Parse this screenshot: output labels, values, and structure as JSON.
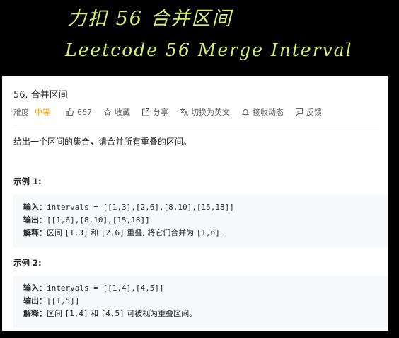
{
  "handwriting": {
    "line1": "力扣 56 合并区间",
    "line2": "Leetcode 56 Merge Interval"
  },
  "problem": {
    "title": "56. 合并区间",
    "difficulty_label": "难度",
    "difficulty": "中等",
    "difficulty_color": "#ffa116",
    "actions": [
      {
        "icon": "thumbs-up-icon",
        "label": "667"
      },
      {
        "icon": "star-icon",
        "label": "收藏"
      },
      {
        "icon": "share-icon",
        "label": "分享"
      },
      {
        "icon": "translate-icon",
        "label": "切换为英文"
      },
      {
        "icon": "bell-icon",
        "label": "接收动态"
      },
      {
        "icon": "feedback-icon",
        "label": "反馈"
      }
    ],
    "description": "给出一个区间的集合，请合并所有重叠的区间。",
    "examples": [
      {
        "title": "示例 1:",
        "input_label": "输入：",
        "input": "intervals = [[1,3],[2,6],[8,10],[15,18]]",
        "output_label": "输出：",
        "output": "[[1,6],[8,10],[15,18]]",
        "explain_label": "解释：",
        "explain_a": "区间 ",
        "explain_b": "[1,3]",
        "explain_c": " 和 ",
        "explain_d": "[2,6]",
        "explain_e": " 重叠, 将它们合并为 ",
        "explain_f": "[1,6]",
        "explain_g": "."
      },
      {
        "title": "示例 2:",
        "input_label": "输入：",
        "input": "intervals = [[1,4],[4,5]]",
        "output_label": "输出：",
        "output": "[[1,5]]",
        "explain_label": "解释：",
        "explain_a": "区间 ",
        "explain_b": "[1,4]",
        "explain_c": " 和 ",
        "explain_d": "[4,5]",
        "explain_e": " 可被视为重叠区间。"
      }
    ]
  }
}
